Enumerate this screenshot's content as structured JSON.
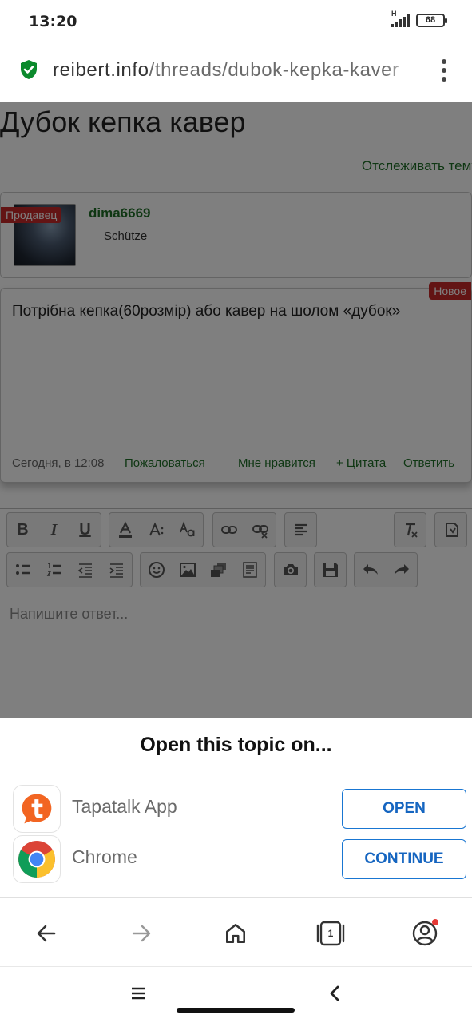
{
  "status_bar": {
    "time": "13:20",
    "network": "H",
    "battery": "68"
  },
  "browser": {
    "url_domain": "reibert.info",
    "url_path": "/threads/dubok-kepka-kaver"
  },
  "thread": {
    "title": "Дубок кепка кавер",
    "watch_label": "Отслеживать тему",
    "user": {
      "badge": "Продавец",
      "name": "dima6669",
      "title": "Schütze"
    },
    "post": {
      "badge": "Новое",
      "text": "Потрібна кепка(60розмір) або кавер на шолом «дубок»",
      "date": "Сегодня, в 12:08",
      "report_label": "Пожаловаться",
      "like_label": "Мне нравится",
      "quote_label": "+ Цитата",
      "reply_label": "Ответить"
    }
  },
  "editor": {
    "placeholder": "Напишите ответ...",
    "toolbar_row1": [
      "bold",
      "italic",
      "underline",
      "text-color",
      "font-size",
      "font-family",
      "link",
      "unlink",
      "align",
      "remove-format",
      "toggle-source"
    ],
    "toolbar_row2": [
      "bullet-list",
      "numbered-list",
      "outdent",
      "indent",
      "smilies",
      "image",
      "media",
      "quote",
      "camera",
      "save-draft",
      "undo",
      "redo"
    ],
    "bold_glyph": "B",
    "italic_glyph": "I",
    "underline_glyph": "U"
  },
  "sheet": {
    "title": "Open this topic on...",
    "apps": [
      {
        "name": "Tapatalk App",
        "button": "OPEN"
      },
      {
        "name": "Chrome",
        "button": "CONTINUE"
      }
    ]
  },
  "browser_nav": {
    "tab_count": "1"
  },
  "colors": {
    "accent": "#1976d2",
    "forum_green": "#1e6e27",
    "badge_red": "#c62828",
    "tapatalk_orange": "#f26522"
  }
}
